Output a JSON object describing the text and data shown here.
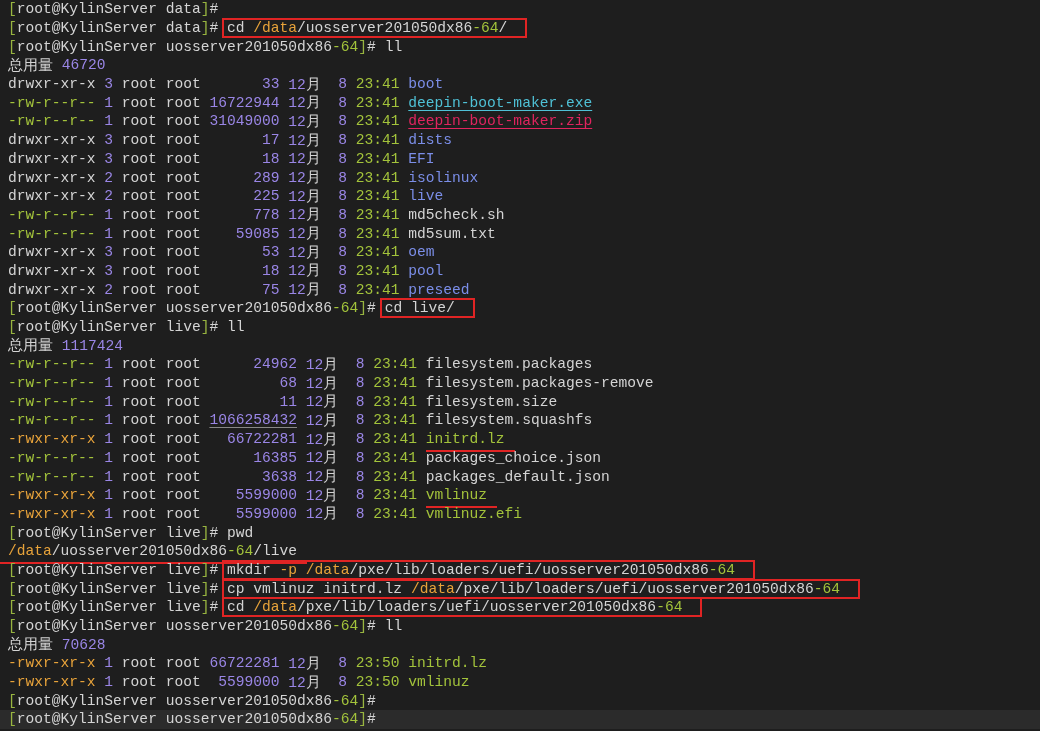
{
  "terminal": {
    "lines": [
      {
        "kind": "prompt",
        "open": "[",
        "user": "root@KylinServer",
        "dir": [
          {
            "text": "data",
            "kind": "plain"
          }
        ],
        "close": "]",
        "sign": "#",
        "highlighted": false
      },
      {
        "kind": "prompt",
        "open": "[",
        "user": "root@KylinServer",
        "dir": [
          {
            "text": "data",
            "kind": "plain"
          }
        ],
        "close": "]",
        "sign": "#",
        "command": [
          {
            "text": "cd ",
            "kind": "plain"
          },
          {
            "text": "/data",
            "kind": "path"
          },
          {
            "text": "/uosserver201050dx86",
            "kind": "plain"
          },
          {
            "text": "-64",
            "kind": "accent"
          },
          {
            "text": "/",
            "kind": "plain"
          }
        ],
        "boxed": true,
        "highlighted": false
      },
      {
        "kind": "prompt",
        "open": "[",
        "user": "root@KylinServer",
        "dir": [
          {
            "text": "uosserver201050dx86",
            "kind": "plain"
          },
          {
            "text": "-64",
            "kind": "accent"
          }
        ],
        "close": "]",
        "sign": "#",
        "command": [
          {
            "text": "ll",
            "kind": "plain"
          }
        ],
        "boxed": false,
        "highlighted": false
      },
      {
        "kind": "total",
        "label": "总用量",
        "value": "46720"
      },
      {
        "kind": "entry",
        "perms": {
          "text": "drwxr-xr-x",
          "kind": "dir"
        },
        "links": "3",
        "owner": "root",
        "group": "root",
        "size": "33",
        "size_underlined": false,
        "month": "12",
        "month_unit": "月",
        "day": "8",
        "time": "23:41",
        "name": {
          "text": "boot",
          "kind": "dir"
        },
        "red_underline": false
      },
      {
        "kind": "entry",
        "perms": {
          "text": "-rw-r--r--",
          "kind": "file"
        },
        "links": "1",
        "owner": "root",
        "group": "root",
        "size": "16722944",
        "size_underlined": false,
        "month": "12",
        "month_unit": "月",
        "day": "8",
        "time": "23:41",
        "name": {
          "text": "deepin-boot-maker.exe",
          "kind": "program"
        },
        "red_underline": false
      },
      {
        "kind": "entry",
        "perms": {
          "text": "-rw-r--r--",
          "kind": "file"
        },
        "links": "1",
        "owner": "root",
        "group": "root",
        "size": "31049000",
        "size_underlined": false,
        "month": "12",
        "month_unit": "月",
        "day": "8",
        "time": "23:41",
        "name": {
          "text": "deepin-boot-maker.zip",
          "kind": "archive"
        },
        "red_underline": false
      },
      {
        "kind": "entry",
        "perms": {
          "text": "drwxr-xr-x",
          "kind": "dir"
        },
        "links": "3",
        "owner": "root",
        "group": "root",
        "size": "17",
        "size_underlined": false,
        "month": "12",
        "month_unit": "月",
        "day": "8",
        "time": "23:41",
        "name": {
          "text": "dists",
          "kind": "dir"
        },
        "red_underline": false
      },
      {
        "kind": "entry",
        "perms": {
          "text": "drwxr-xr-x",
          "kind": "dir"
        },
        "links": "3",
        "owner": "root",
        "group": "root",
        "size": "18",
        "size_underlined": false,
        "month": "12",
        "month_unit": "月",
        "day": "8",
        "time": "23:41",
        "name": {
          "text": "EFI",
          "kind": "dir"
        },
        "red_underline": false
      },
      {
        "kind": "entry",
        "perms": {
          "text": "drwxr-xr-x",
          "kind": "dir"
        },
        "links": "2",
        "owner": "root",
        "group": "root",
        "size": "289",
        "size_underlined": false,
        "month": "12",
        "month_unit": "月",
        "day": "8",
        "time": "23:41",
        "name": {
          "text": "isolinux",
          "kind": "dir"
        },
        "red_underline": false
      },
      {
        "kind": "entry",
        "perms": {
          "text": "drwxr-xr-x",
          "kind": "dir"
        },
        "links": "2",
        "owner": "root",
        "group": "root",
        "size": "225",
        "size_underlined": false,
        "month": "12",
        "month_unit": "月",
        "day": "8",
        "time": "23:41",
        "name": {
          "text": "live",
          "kind": "dir"
        },
        "red_underline": false
      },
      {
        "kind": "entry",
        "perms": {
          "text": "-rw-r--r--",
          "kind": "file"
        },
        "links": "1",
        "owner": "root",
        "group": "root",
        "size": "778",
        "size_underlined": false,
        "month": "12",
        "month_unit": "月",
        "day": "8",
        "time": "23:41",
        "name": {
          "text": "md5check.sh",
          "kind": "file"
        },
        "red_underline": false
      },
      {
        "kind": "entry",
        "perms": {
          "text": "-rw-r--r--",
          "kind": "file"
        },
        "links": "1",
        "owner": "root",
        "group": "root",
        "size": "59085",
        "size_underlined": false,
        "month": "12",
        "month_unit": "月",
        "day": "8",
        "time": "23:41",
        "name": {
          "text": "md5sum.txt",
          "kind": "file"
        },
        "red_underline": false
      },
      {
        "kind": "entry",
        "perms": {
          "text": "drwxr-xr-x",
          "kind": "dir"
        },
        "links": "3",
        "owner": "root",
        "group": "root",
        "size": "53",
        "size_underlined": false,
        "month": "12",
        "month_unit": "月",
        "day": "8",
        "time": "23:41",
        "name": {
          "text": "oem",
          "kind": "dir"
        },
        "red_underline": false
      },
      {
        "kind": "entry",
        "perms": {
          "text": "drwxr-xr-x",
          "kind": "dir"
        },
        "links": "3",
        "owner": "root",
        "group": "root",
        "size": "18",
        "size_underlined": false,
        "month": "12",
        "month_unit": "月",
        "day": "8",
        "time": "23:41",
        "name": {
          "text": "pool",
          "kind": "dir"
        },
        "red_underline": false
      },
      {
        "kind": "entry",
        "perms": {
          "text": "drwxr-xr-x",
          "kind": "dir"
        },
        "links": "2",
        "owner": "root",
        "group": "root",
        "size": "75",
        "size_underlined": false,
        "month": "12",
        "month_unit": "月",
        "day": "8",
        "time": "23:41",
        "name": {
          "text": "preseed",
          "kind": "dir"
        },
        "red_underline": false
      },
      {
        "kind": "prompt",
        "open": "[",
        "user": "root@KylinServer",
        "dir": [
          {
            "text": "uosserver201050dx86",
            "kind": "plain"
          },
          {
            "text": "-64",
            "kind": "accent"
          }
        ],
        "close": "]",
        "sign": "#",
        "command": [
          {
            "text": "cd live/",
            "kind": "plain"
          }
        ],
        "boxed": true,
        "highlighted": false
      },
      {
        "kind": "prompt",
        "open": "[",
        "user": "root@KylinServer",
        "dir": [
          {
            "text": "live",
            "kind": "plain"
          }
        ],
        "close": "]",
        "sign": "#",
        "command": [
          {
            "text": "ll",
            "kind": "plain"
          }
        ],
        "boxed": false,
        "highlighted": false
      },
      {
        "kind": "total",
        "label": "总用量",
        "value": "1117424"
      },
      {
        "kind": "entry",
        "perms": {
          "text": "-rw-r--r--",
          "kind": "file"
        },
        "links": "1",
        "owner": "root",
        "group": "root",
        "size": "24962",
        "size_underlined": false,
        "month": "12",
        "month_unit": "月",
        "day": "8",
        "time": "23:41",
        "name": {
          "text": "filesystem.packages",
          "kind": "file"
        },
        "red_underline": false
      },
      {
        "kind": "entry",
        "perms": {
          "text": "-rw-r--r--",
          "kind": "file"
        },
        "links": "1",
        "owner": "root",
        "group": "root",
        "size": "68",
        "size_underlined": false,
        "month": "12",
        "month_unit": "月",
        "day": "8",
        "time": "23:41",
        "name": {
          "text": "filesystem.packages-remove",
          "kind": "file"
        },
        "red_underline": false
      },
      {
        "kind": "entry",
        "perms": {
          "text": "-rw-r--r--",
          "kind": "file"
        },
        "links": "1",
        "owner": "root",
        "group": "root",
        "size": "11",
        "size_underlined": false,
        "month": "12",
        "month_unit": "月",
        "day": "8",
        "time": "23:41",
        "name": {
          "text": "filesystem.size",
          "kind": "file"
        },
        "red_underline": false
      },
      {
        "kind": "entry",
        "perms": {
          "text": "-rw-r--r--",
          "kind": "file"
        },
        "links": "1",
        "owner": "root",
        "group": "root",
        "size": "1066258432",
        "size_underlined": true,
        "month": "12",
        "month_unit": "月",
        "day": "8",
        "time": "23:41",
        "name": {
          "text": "filesystem.squashfs",
          "kind": "file"
        },
        "red_underline": false
      },
      {
        "kind": "entry",
        "perms": {
          "text": "-rwxr-xr-x",
          "kind": "exec"
        },
        "links": "1",
        "owner": "root",
        "group": "root",
        "size": "66722281",
        "size_underlined": false,
        "month": "12",
        "month_unit": "月",
        "day": "8",
        "time": "23:41",
        "name": {
          "text": "initrd.lz",
          "kind": "exec"
        },
        "red_underline": true
      },
      {
        "kind": "entry",
        "perms": {
          "text": "-rw-r--r--",
          "kind": "file"
        },
        "links": "1",
        "owner": "root",
        "group": "root",
        "size": "16385",
        "size_underlined": false,
        "month": "12",
        "month_unit": "月",
        "day": "8",
        "time": "23:41",
        "name": {
          "text": "packages_choice.json",
          "kind": "file"
        },
        "red_underline": false
      },
      {
        "kind": "entry",
        "perms": {
          "text": "-rw-r--r--",
          "kind": "file"
        },
        "links": "1",
        "owner": "root",
        "group": "root",
        "size": "3638",
        "size_underlined": false,
        "month": "12",
        "month_unit": "月",
        "day": "8",
        "time": "23:41",
        "name": {
          "text": "packages_default.json",
          "kind": "file"
        },
        "red_underline": false
      },
      {
        "kind": "entry",
        "perms": {
          "text": "-rwxr-xr-x",
          "kind": "exec"
        },
        "links": "1",
        "owner": "root",
        "group": "root",
        "size": "5599000",
        "size_underlined": false,
        "month": "12",
        "month_unit": "月",
        "day": "8",
        "time": "23:41",
        "name": {
          "text": "vmlinuz",
          "kind": "exec"
        },
        "red_underline": true
      },
      {
        "kind": "entry",
        "perms": {
          "text": "-rwxr-xr-x",
          "kind": "exec"
        },
        "links": "1",
        "owner": "root",
        "group": "root",
        "size": "5599000",
        "size_underlined": false,
        "month": "12",
        "month_unit": "月",
        "day": "8",
        "time": "23:41",
        "name": {
          "text": "vmlinuz.efi",
          "kind": "exec"
        },
        "red_underline": false
      },
      {
        "kind": "prompt",
        "open": "[",
        "user": "root@KylinServer",
        "dir": [
          {
            "text": "live",
            "kind": "plain"
          }
        ],
        "close": "]",
        "sign": "#",
        "command": [
          {
            "text": "pwd",
            "kind": "plain"
          }
        ],
        "boxed": false,
        "highlighted": false
      },
      {
        "kind": "output",
        "parts": [
          {
            "text": "/data",
            "kind": "path"
          },
          {
            "text": "/uosserver201050dx86",
            "kind": "plain"
          },
          {
            "text": "-64",
            "kind": "accent"
          },
          {
            "text": "/live",
            "kind": "plain"
          }
        ],
        "red_underline": true
      },
      {
        "kind": "prompt",
        "open": "[",
        "user": "root@KylinServer",
        "dir": [
          {
            "text": "live",
            "kind": "plain"
          }
        ],
        "close": "]",
        "sign": "#",
        "command": [
          {
            "text": "mkdir ",
            "kind": "plain"
          },
          {
            "text": "-p ",
            "kind": "path"
          },
          {
            "text": "/data",
            "kind": "path"
          },
          {
            "text": "/pxe/lib/loaders/uefi/uosserver201050dx86",
            "kind": "plain"
          },
          {
            "text": "-64",
            "kind": "accent"
          }
        ],
        "boxed": true,
        "highlighted": false
      },
      {
        "kind": "prompt",
        "open": "[",
        "user": "root@KylinServer",
        "dir": [
          {
            "text": "live",
            "kind": "plain"
          }
        ],
        "close": "]",
        "sign": "#",
        "command": [
          {
            "text": "cp vmlinuz initrd.lz ",
            "kind": "plain"
          },
          {
            "text": "/data",
            "kind": "path"
          },
          {
            "text": "/pxe/lib/loaders/uefi/uosserver201050dx86",
            "kind": "plain"
          },
          {
            "text": "-64",
            "kind": "accent"
          }
        ],
        "boxed": true,
        "highlighted": false
      },
      {
        "kind": "prompt",
        "open": "[",
        "user": "root@KylinServer",
        "dir": [
          {
            "text": "live",
            "kind": "plain"
          }
        ],
        "close": "]",
        "sign": "#",
        "command": [
          {
            "text": "cd ",
            "kind": "plain"
          },
          {
            "text": "/data",
            "kind": "path"
          },
          {
            "text": "/pxe/lib/loaders/uefi/uosserver201050dx86",
            "kind": "plain"
          },
          {
            "text": "-64",
            "kind": "accent"
          }
        ],
        "boxed": true,
        "highlighted": false
      },
      {
        "kind": "prompt",
        "open": "[",
        "user": "root@KylinServer",
        "dir": [
          {
            "text": "uosserver201050dx86",
            "kind": "plain"
          },
          {
            "text": "-64",
            "kind": "accent"
          }
        ],
        "close": "]",
        "sign": "#",
        "command": [
          {
            "text": "ll",
            "kind": "plain"
          }
        ],
        "boxed": false,
        "highlighted": false
      },
      {
        "kind": "total",
        "label": "总用量",
        "value": "70628"
      },
      {
        "kind": "entry",
        "perms": {
          "text": "-rwxr-xr-x",
          "kind": "exec"
        },
        "links": "1",
        "owner": "root",
        "group": "root",
        "size": "66722281",
        "size_underlined": false,
        "month": "12",
        "month_unit": "月",
        "day": "8",
        "time": "23:50",
        "name": {
          "text": "initrd.lz",
          "kind": "exec"
        },
        "red_underline": false
      },
      {
        "kind": "entry",
        "perms": {
          "text": "-rwxr-xr-x",
          "kind": "exec"
        },
        "links": "1",
        "owner": "root",
        "group": "root",
        "size": "5599000",
        "size_underlined": false,
        "month": "12",
        "month_unit": "月",
        "day": "8",
        "time": "23:50",
        "name": {
          "text": "vmlinuz",
          "kind": "exec"
        },
        "red_underline": false
      },
      {
        "kind": "prompt",
        "open": "[",
        "user": "root@KylinServer",
        "dir": [
          {
            "text": "uosserver201050dx86",
            "kind": "plain"
          },
          {
            "text": "-64",
            "kind": "accent"
          }
        ],
        "close": "]",
        "sign": "#",
        "highlighted": false
      },
      {
        "kind": "prompt",
        "open": "[",
        "user": "root@KylinServer",
        "dir": [
          {
            "text": "uosserver201050dx86",
            "kind": "plain"
          },
          {
            "text": "-64",
            "kind": "accent"
          }
        ],
        "close": "]",
        "sign": "#",
        "highlighted": true
      }
    ]
  }
}
